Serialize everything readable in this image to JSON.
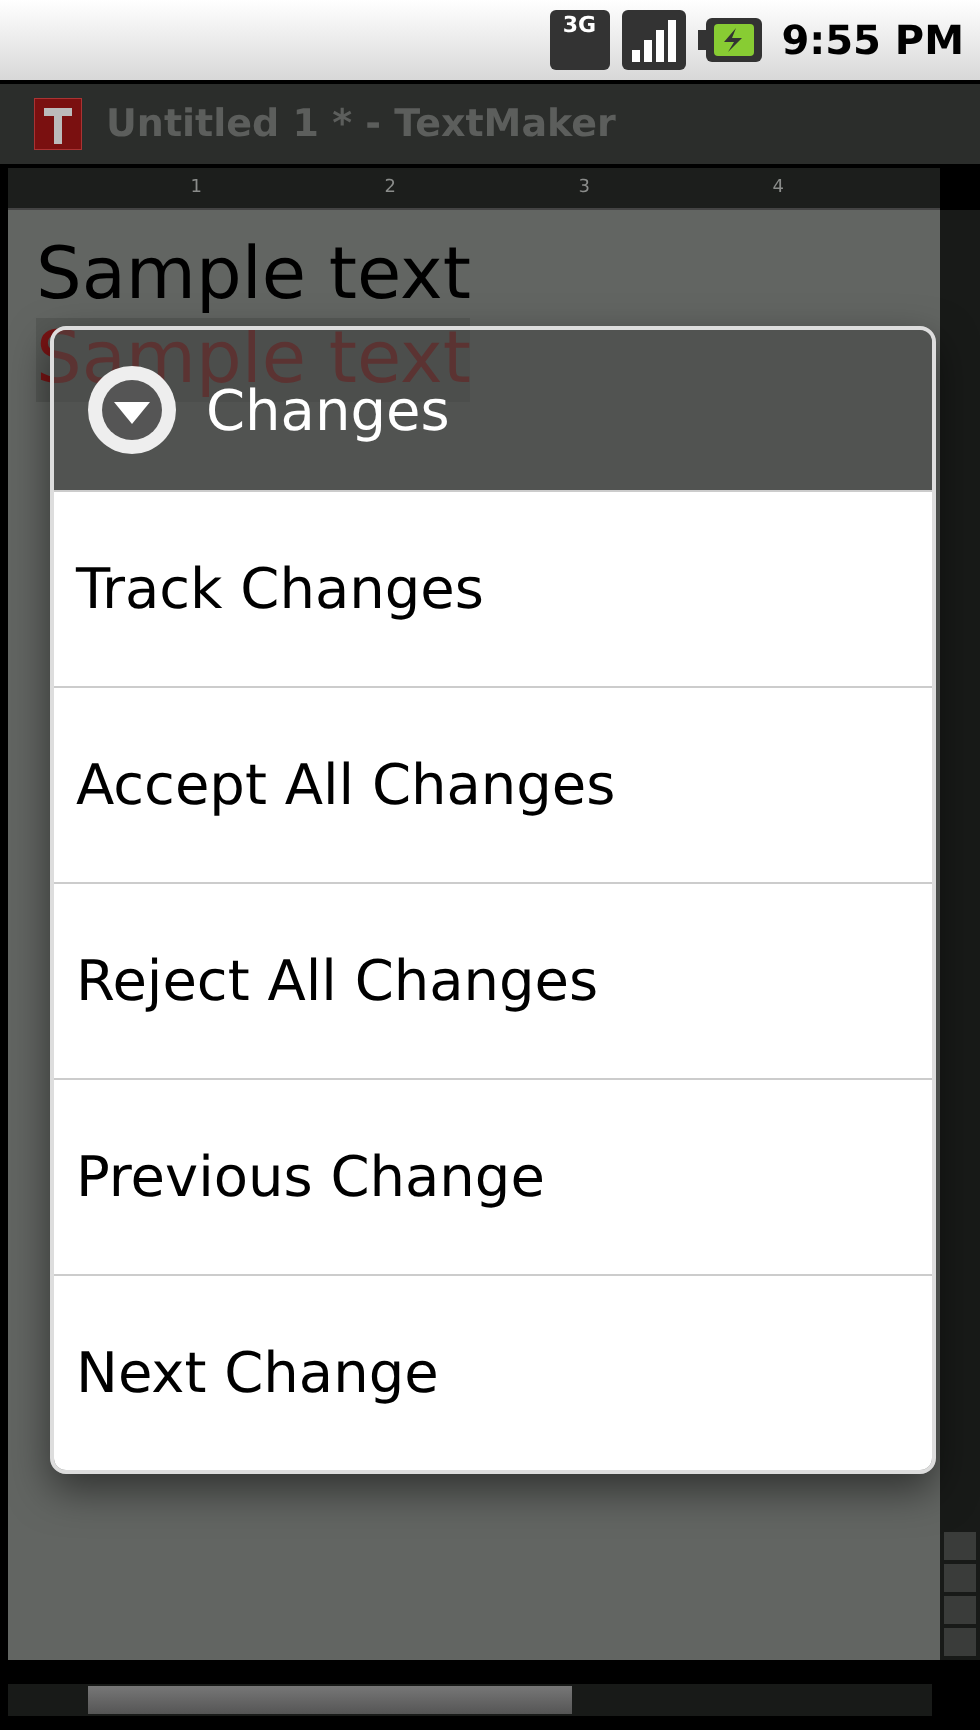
{
  "status_bar": {
    "time": "9:55 PM",
    "network": "3G"
  },
  "window": {
    "title": "Untitled 1 * - TextMaker"
  },
  "ruler": {
    "labels": [
      "1",
      "2",
      "3",
      "4"
    ]
  },
  "document": {
    "lines": [
      {
        "text": "Sample text",
        "kind": "plain"
      },
      {
        "text": "Sample text",
        "kind": "tracked"
      }
    ]
  },
  "dialog": {
    "title": "Changes",
    "items": [
      "Track Changes",
      "Accept All Changes",
      "Reject All Changes",
      "Previous Change",
      "Next Change"
    ]
  }
}
